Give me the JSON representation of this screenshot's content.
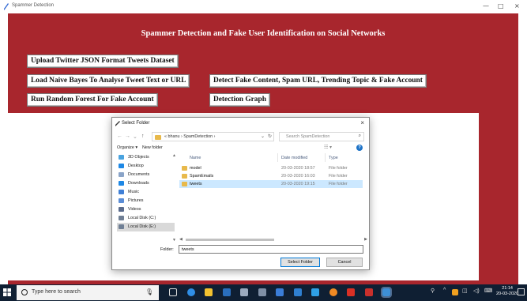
{
  "window": {
    "title": "Spammer Detection",
    "controls": [
      "—",
      "□",
      "×"
    ]
  },
  "app": {
    "heading": "Spammer Detection and Fake User Identification on Social Networks",
    "buttons": {
      "upload": "Upload Twitter JSON Format Tweets Dataset",
      "naive_bayes": "Load Naive Bayes To Analyse Tweet Text or URL",
      "detect": "Detect Fake Content, Spam URL, Trending Topic & Fake Account",
      "random_forest": "Run Random Forest For Fake Account",
      "graph": "Detection Graph"
    }
  },
  "dialog": {
    "title": "Select Folder",
    "close": "×",
    "path": "« bhanu › SpamDetection ›",
    "search_placeholder": "Search SpamDetection",
    "organize": "Organize ▾",
    "new_folder": "New folder",
    "nav_items": [
      {
        "label": "3D Objects",
        "icon": "cube-icon",
        "color": "#4aa3df"
      },
      {
        "label": "Desktop",
        "icon": "desktop-icon",
        "color": "#1e88e5"
      },
      {
        "label": "Documents",
        "icon": "documents-icon",
        "color": "#8aa4c8"
      },
      {
        "label": "Downloads",
        "icon": "download-icon",
        "color": "#1e88e5"
      },
      {
        "label": "Music",
        "icon": "music-icon",
        "color": "#3f7fd6"
      },
      {
        "label": "Pictures",
        "icon": "pictures-icon",
        "color": "#5b8dd6"
      },
      {
        "label": "Videos",
        "icon": "videos-icon",
        "color": "#5a6b8c"
      },
      {
        "label": "Local Disk (C:)",
        "icon": "drive-icon",
        "color": "#6f7f95"
      },
      {
        "label": "Local Disk (E:)",
        "icon": "drive-icon",
        "color": "#6f7f95"
      }
    ],
    "columns": {
      "name": "Name",
      "date": "Date modified",
      "type": "Type"
    },
    "files": [
      {
        "name": "model",
        "date": "20-03-2020 18:57",
        "type": "File folder"
      },
      {
        "name": "SpamEmails",
        "date": "20-03-2020 16:03",
        "type": "File folder"
      },
      {
        "name": "tweets",
        "date": "20-03-2020 19:15",
        "type": "File folder"
      }
    ],
    "selected_file": "tweets",
    "folder_label": "Folder:",
    "folder_value": "tweets",
    "select_button": "Select Folder",
    "cancel_button": "Cancel"
  },
  "taskbar": {
    "search_placeholder": "Type here to search",
    "time": "21:14",
    "date": "20-03-2020"
  },
  "colors": {
    "app_background": "#a8262d",
    "taskbar": "#0f1f33",
    "selection": "#cce8ff"
  }
}
